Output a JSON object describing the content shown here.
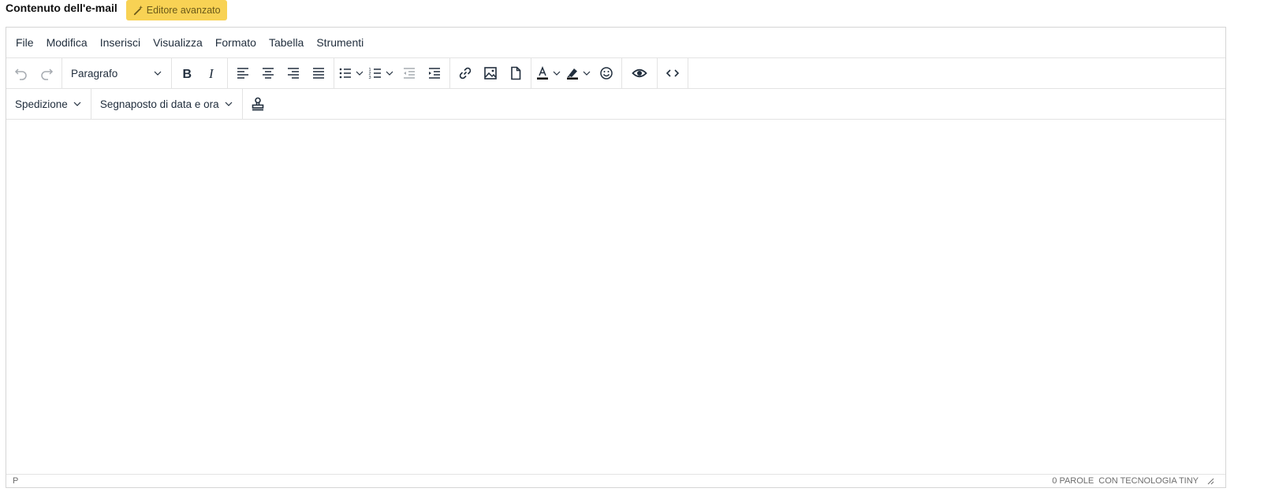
{
  "header": {
    "title": "Contenuto dell'e-mail",
    "advanced_editor_label": "Editore avanzato"
  },
  "menubar": {
    "items": [
      "File",
      "Modifica",
      "Inserisci",
      "Visualizza",
      "Formato",
      "Tabella",
      "Strumenti"
    ]
  },
  "toolbar": {
    "block_format": "Paragrafo",
    "shipping_menu": "Spedizione",
    "datetime_placeholder_menu": "Segnaposto di data e ora"
  },
  "statusbar": {
    "path": "P",
    "word_count": "0 PAROLE",
    "branding": "CON TECNOLOGIA TINY"
  },
  "colors": {
    "accent_button": "#f8d254",
    "border": "#d5d5d5"
  }
}
